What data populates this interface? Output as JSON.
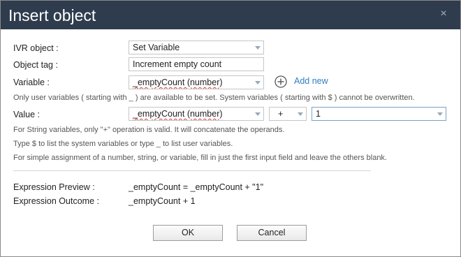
{
  "dialog": {
    "title": "Insert object",
    "close_glyph": "×"
  },
  "form": {
    "ivr_object": {
      "label": "IVR object :",
      "value": "Set Variable"
    },
    "object_tag": {
      "label": "Object tag :",
      "value": "Increment empty count"
    },
    "variable": {
      "label": "Variable :",
      "value": "_emptyCount (number)",
      "add_new_label": "Add new"
    },
    "variable_note": "Only user variables ( starting with _ ) are available to be set. System variables ( starting with $ ) cannot be overwritten.",
    "value": {
      "label": "Value :",
      "operand1": "_emptyCount (number)",
      "operator": "+",
      "operand2": "1"
    },
    "notes": [
      "For String variables, only \"+\" operation is valid. It will concatenate the operands.",
      "Type $ to list the system variables or type _ to list user variables.",
      "For simple assignment of a number, string, or variable, fill in just the first input field and leave the others blank."
    ]
  },
  "expression": {
    "preview_label": "Expression Preview :",
    "preview_value": "_emptyCount = _emptyCount + \"1\"",
    "outcome_label": "Expression Outcome :",
    "outcome_value": "_emptyCount + 1"
  },
  "buttons": {
    "ok": "OK",
    "cancel": "Cancel"
  },
  "icons": {
    "close": "close-icon",
    "add": "plus-circle-icon",
    "dropdown": "chevron-down-icon"
  },
  "colors": {
    "titlebar": "#2e3c4e",
    "link": "#2f7fc0",
    "spellcheck": "#d04040"
  }
}
